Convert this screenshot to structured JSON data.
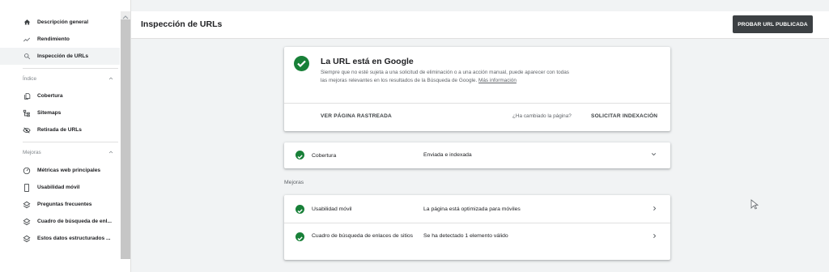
{
  "sidebar": {
    "items": [
      {
        "label": "Descripción general",
        "icon": "home-icon"
      },
      {
        "label": "Rendimiento",
        "icon": "trending-up-icon"
      },
      {
        "label": "Inspección de URLs",
        "icon": "search-icon"
      }
    ],
    "index_section": {
      "title": "Índice",
      "items": [
        {
          "label": "Cobertura",
          "icon": "file-copy-icon"
        },
        {
          "label": "Sitemaps",
          "icon": "sitemap-icon"
        },
        {
          "label": "Retirada de URLs",
          "icon": "eye-off-icon"
        }
      ]
    },
    "mejoras_section": {
      "title": "Mejoras",
      "items": [
        {
          "label": "Métricas web principales",
          "icon": "gauge-icon"
        },
        {
          "label": "Usabilidad móvil",
          "icon": "smartphone-icon"
        },
        {
          "label": "Preguntas frecuentes",
          "icon": "layers-icon"
        },
        {
          "label": "Cuadro de búsqueda de enl...",
          "icon": "layers-icon"
        },
        {
          "label": "Estos datos estructurados ...",
          "icon": "layers-icon"
        }
      ]
    }
  },
  "header": {
    "title": "Inspección de URLs",
    "button_label": "PROBAR URL PUBLICADA"
  },
  "status": {
    "title": "La URL está en Google",
    "description": "Siempre que no esté sujeta a una solicitud de eliminación o a una acción manual, puede aparecer con todas las mejoras relevantes en los resultados de la Búsqueda de Google.",
    "link": "Más información",
    "view_crawled": "VER PÁGINA RASTREADA",
    "changed_question": "¿Ha cambiado la página?",
    "request_indexing": "SOLICITAR INDEXACIÓN"
  },
  "coverage": {
    "label": "Cobertura",
    "value": "Enviada e indexada"
  },
  "mejoras": {
    "heading": "Mejoras",
    "rows": [
      {
        "label": "Usabilidad móvil",
        "value": "La página está optimizada para móviles"
      },
      {
        "label": "Cuadro de búsqueda de enlaces de sitios",
        "value": "Se ha detectado 1 elemento válido"
      }
    ]
  },
  "colors": {
    "success": "#188038",
    "button_bg": "#3c4043",
    "background": "#f1f3f4"
  }
}
